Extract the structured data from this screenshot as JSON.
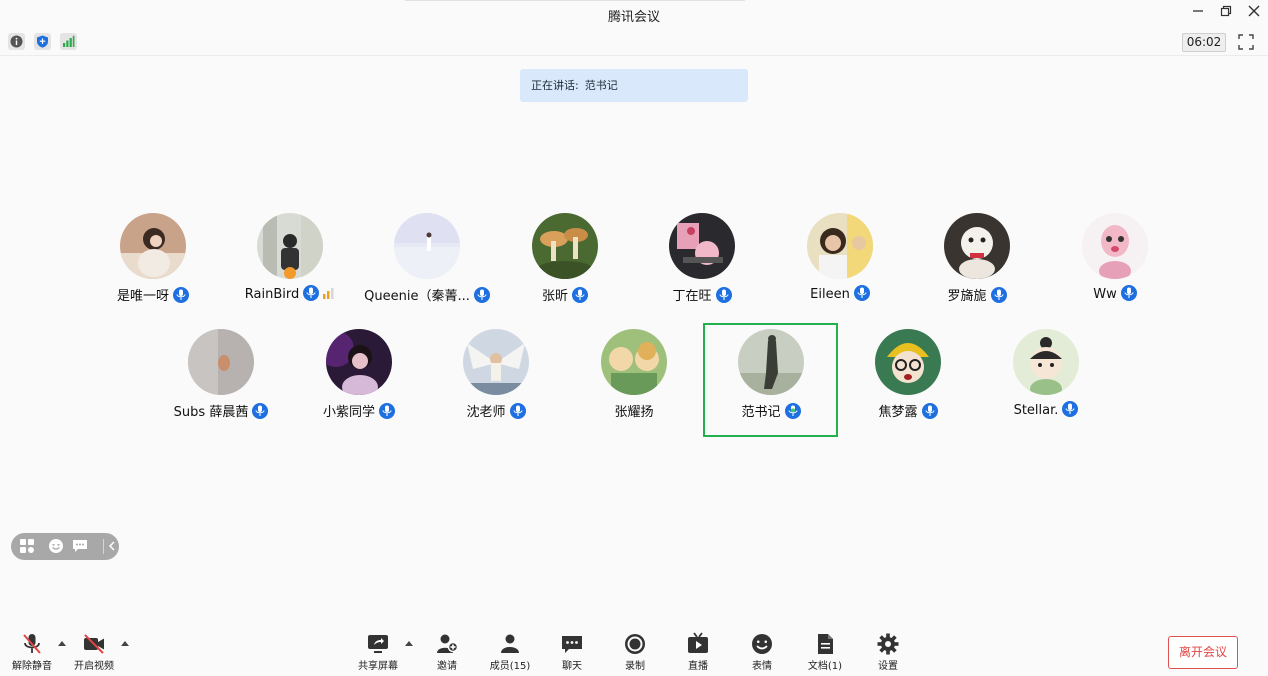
{
  "window": {
    "title": "腾讯会议",
    "timer": "06:02"
  },
  "speaking": {
    "label": "正在讲话:",
    "name": "范书记"
  },
  "participants": [
    {
      "name": "是唯一呀"
    },
    {
      "name": "RainBird"
    },
    {
      "name": "Queenie（秦菁..."
    },
    {
      "name": "张昕"
    },
    {
      "name": "丁在旺"
    },
    {
      "name": "Eileen"
    },
    {
      "name": "罗旖旎"
    },
    {
      "name": "Ww"
    },
    {
      "name": "Subs 薛晨茜"
    },
    {
      "name": "小紫同学"
    },
    {
      "name": "沈老师"
    },
    {
      "name": "张耀扬"
    },
    {
      "name": "范书记"
    },
    {
      "name": "焦梦露"
    },
    {
      "name": "Stellar."
    }
  ],
  "toolbar": {
    "unmute": "解除静音",
    "start_video": "开启视频",
    "share": "共享屏幕",
    "invite": "邀请",
    "members": "成员(15)",
    "chat": "聊天",
    "record": "录制",
    "live": "直播",
    "reactions": "表情",
    "docs": "文档(1)",
    "settings": "设置",
    "leave": "离开会议"
  },
  "colors": {
    "accent": "#1e6fe0",
    "active_speaker": "#25b050",
    "leave": "#e04545"
  }
}
